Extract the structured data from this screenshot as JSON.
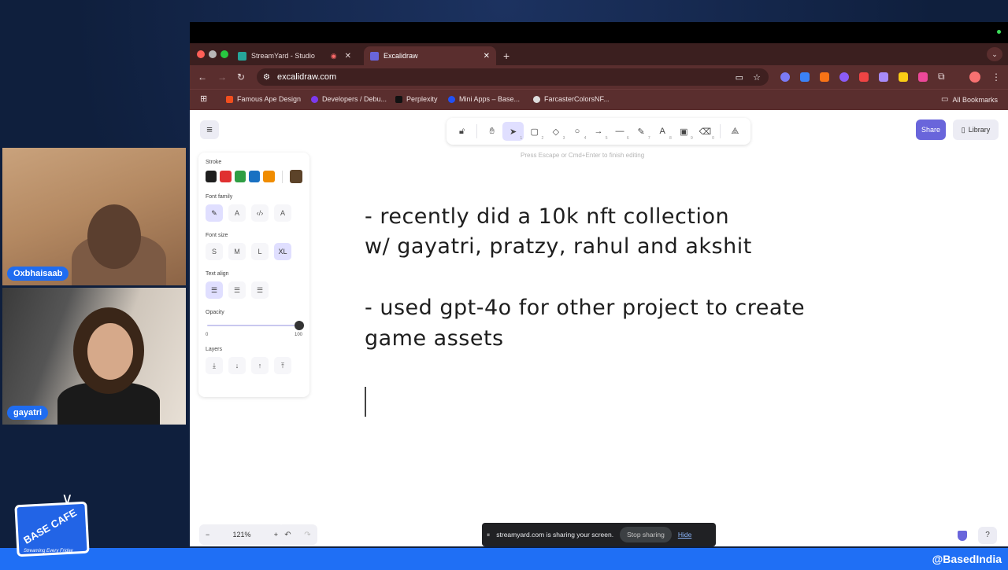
{
  "participants": [
    {
      "name": "Oxbhaisaab"
    },
    {
      "name": "gayatri"
    }
  ],
  "branding": {
    "logo_text": "BASE CAFE",
    "tagline": "Streaming Every Friday",
    "handle": "@BasedIndia"
  },
  "browser": {
    "tabs": [
      {
        "label": "StreamYard - Studio",
        "active": false
      },
      {
        "label": "Excalidraw",
        "active": true
      }
    ],
    "new_tab": "+",
    "url": "excalidraw.com",
    "bookmarks": [
      {
        "label": "Famous Ape Design"
      },
      {
        "label": "Developers / Debu..."
      },
      {
        "label": "Perplexity"
      },
      {
        "label": "Mini Apps – Base..."
      },
      {
        "label": "FarcasterColorsNF..."
      }
    ],
    "all_bookmarks": "All Bookmarks"
  },
  "excalidraw": {
    "hint": "Press Escape or Cmd+Enter to finish editing",
    "share": "Share",
    "library": "Library",
    "tools": [
      "lock-icon",
      "hand-icon",
      "select-icon",
      "rectangle-icon",
      "diamond-icon",
      "ellipse-icon",
      "arrow-icon",
      "line-icon",
      "pencil-icon",
      "text-icon",
      "image-icon",
      "eraser-icon",
      "extra-tools-icon"
    ],
    "props": {
      "stroke_label": "Stroke",
      "stroke_colors": [
        "#1e1e1e",
        "#e03131",
        "#2f9e44",
        "#1971c2",
        "#f08c00"
      ],
      "stroke_current": "#5c4329",
      "font_family_label": "Font family",
      "font_size_label": "Font size",
      "font_sizes": [
        "S",
        "M",
        "L",
        "XL"
      ],
      "font_size_selected": "XL",
      "text_align_label": "Text align",
      "opacity_label": "Opacity",
      "opacity_min": "0",
      "opacity_max": "100",
      "opacity_value": 100,
      "layers_label": "Layers"
    },
    "canvas_text": [
      "- recently did a 10k nft collection",
      "w/ gayatri, pratzy, rahul and akshit",
      "- used gpt-4o for other project to create",
      "game assets"
    ],
    "zoom": "121%",
    "zoom_minus": "−",
    "zoom_plus": "+"
  },
  "share_notice": {
    "text": "streamyard.com is sharing your screen.",
    "stop": "Stop sharing",
    "hide": "Hide"
  }
}
